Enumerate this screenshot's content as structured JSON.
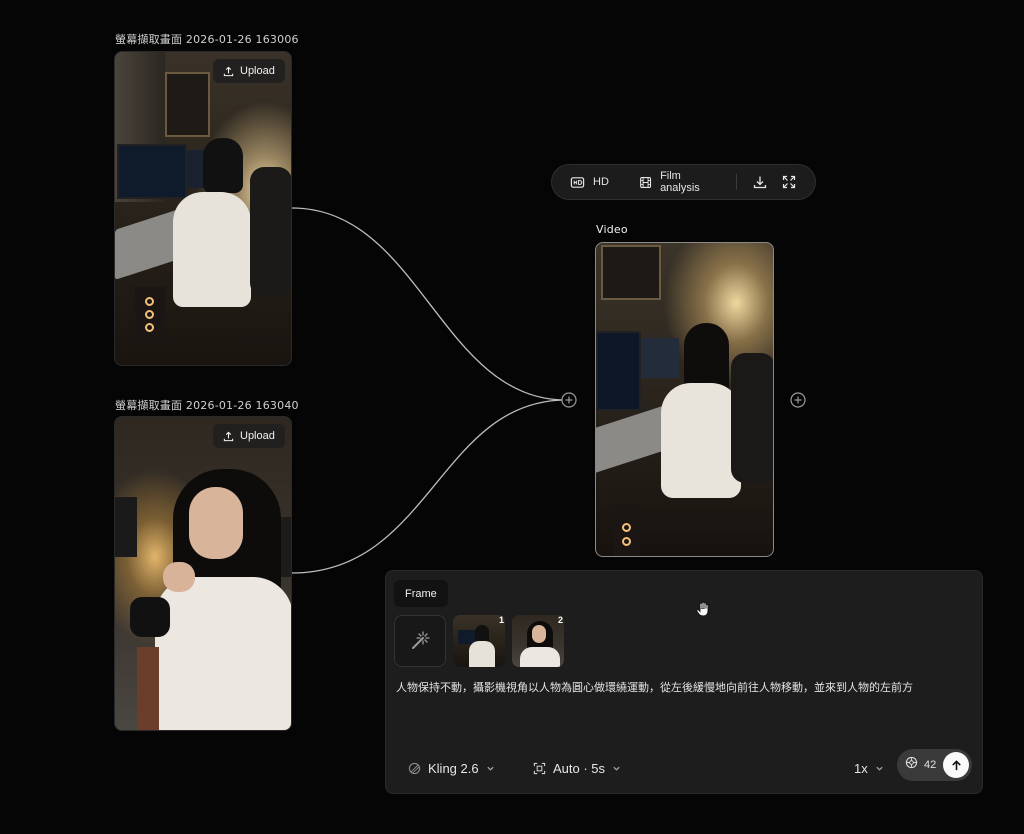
{
  "nodes": {
    "image1": {
      "title": "螢幕擷取畫面 2026-01-26 163006",
      "upload_label": "Upload"
    },
    "image2": {
      "title": "螢幕擷取畫面 2026-01-26 163040",
      "upload_label": "Upload"
    },
    "video": {
      "title": "Video"
    }
  },
  "toolbar": {
    "hd_label": "HD",
    "film_label": "Film analysis",
    "download_icon": "download-icon",
    "fullscreen_icon": "fullscreen-icon"
  },
  "prompt_panel": {
    "frame_label": "Frame",
    "thumb_numbers": [
      "1",
      "2"
    ],
    "prompt": "人物保持不動，攝影機視角以人物為圓心做環繞運動，從左後緩慢地向前往人物移動，並來到人物的左前方",
    "model": "Kling 2.6",
    "duration": "Auto · 5s",
    "speed": "1x",
    "credits": "42"
  },
  "colors": {
    "background": "#050505",
    "panel": "#1d1d1d",
    "connector": "#bdbdbd",
    "send_button": "#fafafa"
  }
}
